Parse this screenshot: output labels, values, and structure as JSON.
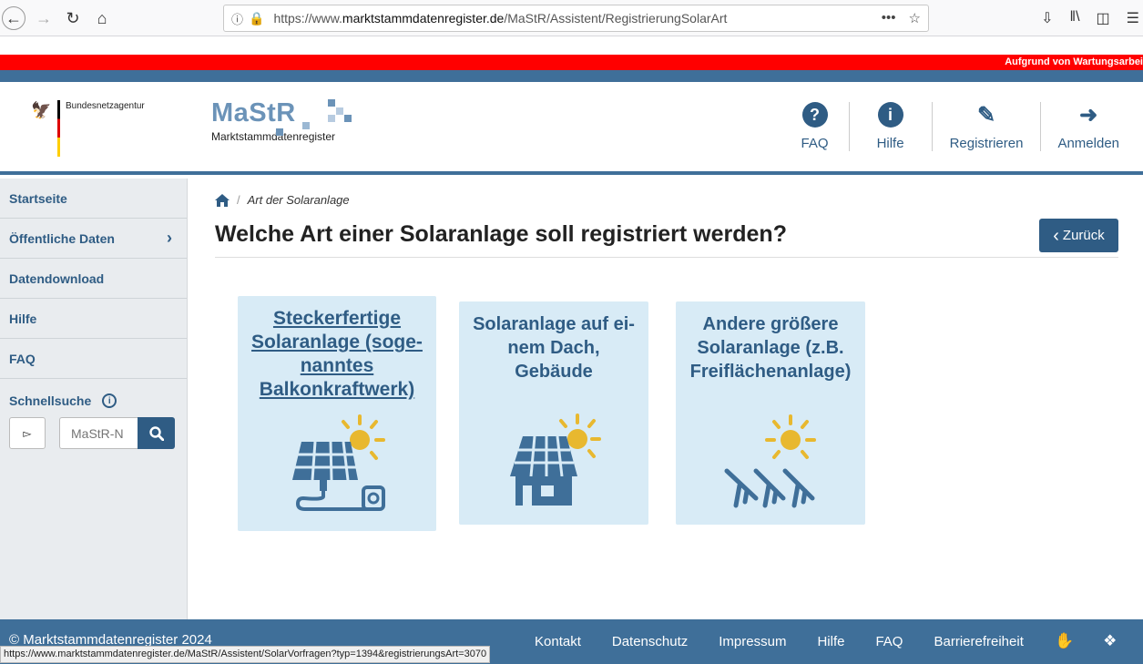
{
  "browser": {
    "url_prefix": "https://www.",
    "url_host": "marktstammdatenregister.de",
    "url_path": "/MaStR/Assistent/RegistrierungSolarArt"
  },
  "banner": {
    "text": "Aufgrund von Wartungsarbei"
  },
  "header": {
    "org_name": "Bundesnetzagentur",
    "logo_word": "MaStR",
    "logo_sub": "Marktstammdatenregister",
    "links": [
      {
        "label": "FAQ",
        "icon": "question-icon"
      },
      {
        "label": "Hilfe",
        "icon": "info-icon"
      },
      {
        "label": "Registrieren",
        "icon": "edit-icon"
      },
      {
        "label": "Anmelden",
        "icon": "sign-in-icon"
      }
    ]
  },
  "sidebar": {
    "items": [
      {
        "label": "Startseite"
      },
      {
        "label": "Öffentliche Daten"
      },
      {
        "label": "Datendownload"
      },
      {
        "label": "Hilfe"
      },
      {
        "label": "FAQ"
      }
    ],
    "quick_search": {
      "title": "Schnellsuche",
      "placeholder": "MaStR-N"
    }
  },
  "main": {
    "breadcrumb": "Art der Solaranlage",
    "title": "Welche Art einer Solaranlage soll registriert werden?",
    "back_label": "Zurück",
    "cards": [
      {
        "label": "Steckerfertige Solaranlage (soge-nanntes Balkonkraftwerk)"
      },
      {
        "label": "Solaranlage auf ei-nem Dach, Gebäude"
      },
      {
        "label": "Andere größere Solaranlage (z.B. Freiflächenanlage)"
      }
    ]
  },
  "footer": {
    "copyright": "© Marktstammdatenregister 2024",
    "links": [
      "Kontakt",
      "Datenschutz",
      "Impressum",
      "Hilfe",
      "FAQ",
      "Barrierefreiheit"
    ]
  },
  "status_bar": "https://www.marktstammdatenregister.de/MaStR/Assistent/SolarVorfragen?typ=1394&registrierungsArt=3070",
  "colors": {
    "primary": "#2f5c84",
    "card_bg": "#d8ebf6",
    "sun": "#e8b82f",
    "alert": "#ff0000"
  }
}
